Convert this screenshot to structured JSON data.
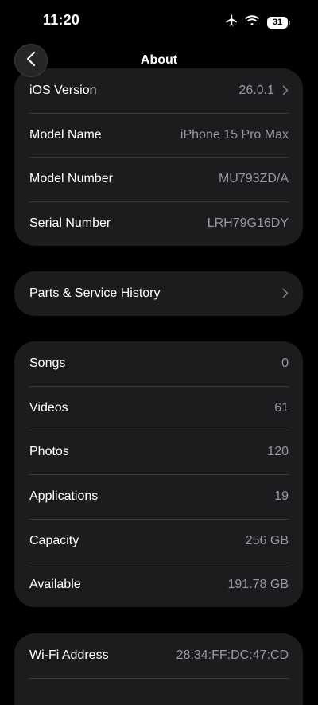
{
  "status_bar": {
    "time": "11:20",
    "battery_level": "31",
    "icons": [
      "airplane-icon",
      "wifi-icon",
      "battery-icon"
    ]
  },
  "nav": {
    "title": "About",
    "back_icon": "chevron-left-icon"
  },
  "device_group": [
    {
      "label": "iOS Version",
      "value": "26.0.1",
      "chevron": true
    },
    {
      "label": "Model Name",
      "value": "iPhone 15 Pro Max"
    },
    {
      "label": "Model Number",
      "value": "MU793ZD/A"
    },
    {
      "label": "Serial Number",
      "value": "LRH79G16DY"
    }
  ],
  "parts_group": {
    "label": "Parts & Service History",
    "chevron": true
  },
  "media_group": [
    {
      "label": "Songs",
      "value": "0"
    },
    {
      "label": "Videos",
      "value": "61"
    },
    {
      "label": "Photos",
      "value": "120"
    },
    {
      "label": "Applications",
      "value": "19"
    },
    {
      "label": "Capacity",
      "value": "256 GB"
    },
    {
      "label": "Available",
      "value": "191.78 GB"
    }
  ],
  "network_group": [
    {
      "label": "Wi-Fi Address",
      "value": "28:34:FF:DC:47:CD"
    }
  ],
  "colors": {
    "background": "#000000",
    "group_background": "#1c1c1e",
    "separator": "#38383a",
    "secondary_text": "#98989f",
    "primary_text": "#ffffff"
  }
}
